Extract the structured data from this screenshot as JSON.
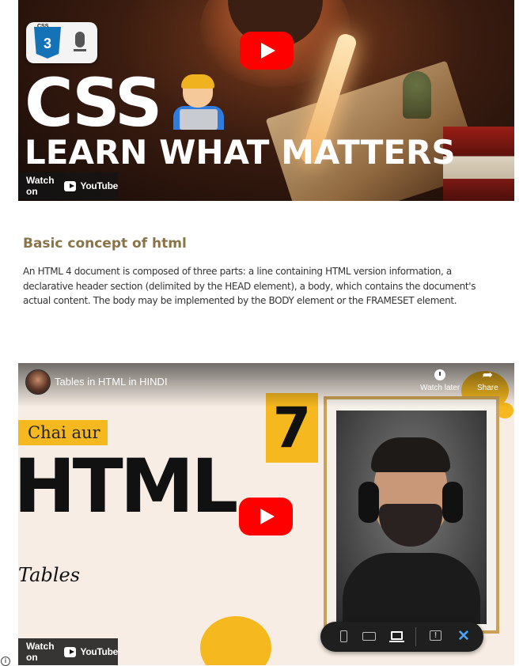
{
  "video1": {
    "badge_css_label": "CSS",
    "badge_css_number": "3",
    "title_line1": "CSS",
    "title_line2": "LEARN WHAT MATTERS",
    "watch_on_label": "Watch on",
    "youtube_label": "YouTube"
  },
  "article": {
    "heading": "Basic concept of html",
    "body": "An HTML 4 document is composed of three parts: a line containing HTML version information, a declarative header section (delimited by the HEAD element), a body, which contains the document's actual content. The body may be implemented by the BODY element or the FRAMESET element."
  },
  "video2": {
    "video_title": "Tables in HTML in HINDI",
    "watch_later_label": "Watch later",
    "share_label": "Share",
    "tag_text": "Chai aur",
    "episode_number": "7",
    "big_word": "HTML",
    "subtitle_word": "Tables",
    "watch_on_label": "Watch on",
    "youtube_label": "YouTube"
  },
  "device_toolbar": {
    "icons": [
      "phone-icon",
      "tablet-icon",
      "laptop-icon",
      "feedback-icon",
      "close-icon"
    ],
    "active": "laptop-icon",
    "close_color": "#4aa3f0"
  },
  "colors": {
    "heading": "#8a7346",
    "accent_yellow": "#f5b81f",
    "youtube_red": "#ff0000"
  }
}
